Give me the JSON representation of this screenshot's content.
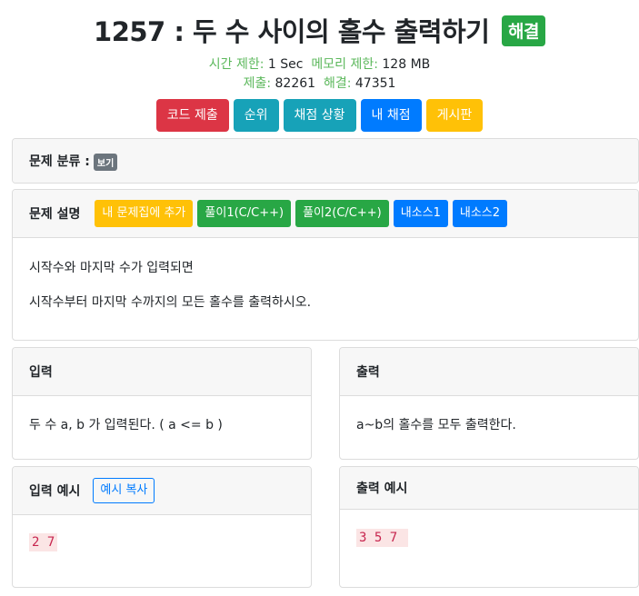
{
  "problem": {
    "number": "1257",
    "sep": " : ",
    "title": "두 수 사이의 홀수 출력하기",
    "solved_badge": "해결"
  },
  "meta": {
    "time_label": "시간 제한:",
    "time_value": "1 Sec",
    "memory_label": "메모리 제한:",
    "memory_value": "128 MB",
    "submit_label": "제출:",
    "submit_value": "82261",
    "solved_label": "해결:",
    "solved_value": "47351"
  },
  "buttons": {
    "submit_code": "코드 제출",
    "ranking": "순위",
    "judge_status": "채점 상황",
    "my_judge": "내 채점",
    "board": "게시판"
  },
  "category": {
    "label": "문제 분류 :",
    "view": "보기"
  },
  "description": {
    "label": "문제 설명",
    "add_to_set": "내 문제집에 추가",
    "solution1": "풀이1(C/C++)",
    "solution2": "풀이2(C/C++)",
    "mysource1": "내소스1",
    "mysource2": "내소스2",
    "paragraphs": [
      "시작수와 마지막 수가 입력되면",
      "시작수부터 마지막 수까지의 모든 홀수를 출력하시오."
    ]
  },
  "input": {
    "label": "입력",
    "text": "두 수 a, b 가 입력된다. ( a <= b )"
  },
  "output": {
    "label": "출력",
    "text": "a~b의 홀수를 모두 출력한다."
  },
  "input_example": {
    "label": "입력 예시",
    "copy": "예시 복사",
    "value": "2 7"
  },
  "output_example": {
    "label": "출력 예시",
    "value": "3 5 7 "
  },
  "colors": {
    "solved_green": "#28a745",
    "meta_label": "#5cb85c",
    "danger": "#dc3545",
    "info": "#17a2b8",
    "primary": "#007bff",
    "warning": "#ffc107",
    "code_bg": "#fbe5e5"
  }
}
